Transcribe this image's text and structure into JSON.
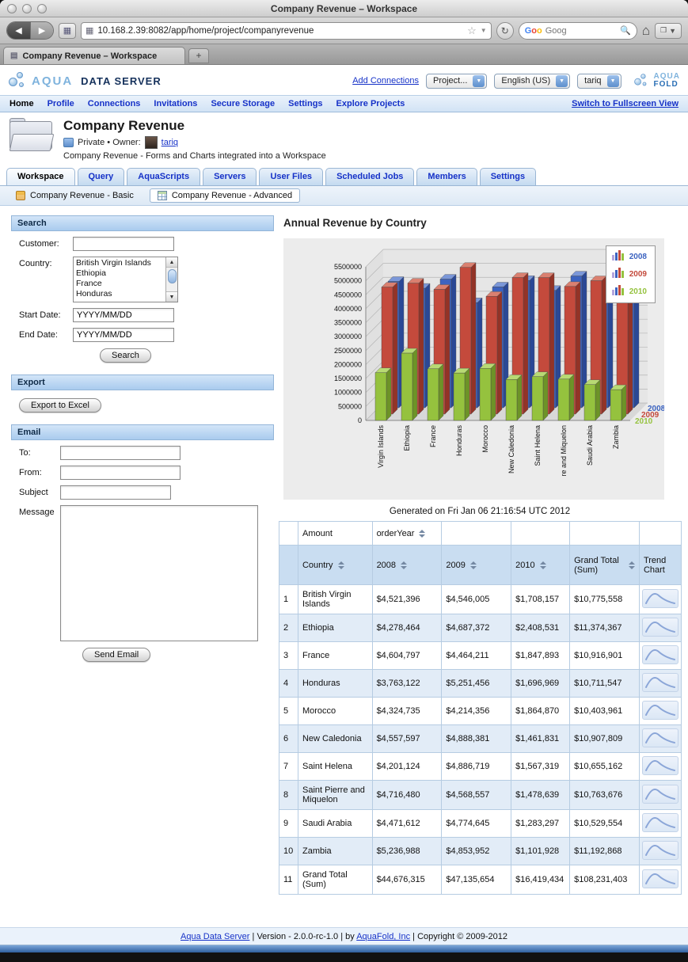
{
  "browser": {
    "window_title": "Company Revenue – Workspace",
    "url": "10.168.2.39:8082/app/home/project/companyrevenue",
    "tab_title": "Company Revenue – Workspace",
    "search_text": "Goog"
  },
  "header": {
    "brand_left_primary": "AQUA",
    "brand_left_secondary": "DATA SERVER",
    "add_connections": "Add Connections",
    "project_dropdown": "Project...",
    "language_dropdown": "English (US)",
    "user_dropdown": "tariq",
    "brand_right_line1": "AQUA",
    "brand_right_line2": "FOLD"
  },
  "nav": {
    "items": [
      {
        "label": "Home",
        "active": true
      },
      {
        "label": "Profile",
        "active": false
      },
      {
        "label": "Connections",
        "active": false
      },
      {
        "label": "Invitations",
        "active": false
      },
      {
        "label": "Secure Storage",
        "active": false
      },
      {
        "label": "Settings",
        "active": false
      },
      {
        "label": "Explore Projects",
        "active": false
      }
    ],
    "fullscreen_link": "Switch to Fullscreen View"
  },
  "project": {
    "title": "Company Revenue",
    "privacy_owner": "Private •  Owner:",
    "owner": "tariq",
    "description": "Company Revenue - Forms and Charts integrated into a Workspace"
  },
  "tabs": {
    "items": [
      {
        "label": "Workspace",
        "active": true
      },
      {
        "label": "Query",
        "active": false
      },
      {
        "label": "AquaScripts",
        "active": false
      },
      {
        "label": "Servers",
        "active": false
      },
      {
        "label": "User Files",
        "active": false
      },
      {
        "label": "Scheduled Jobs",
        "active": false
      },
      {
        "label": "Members",
        "active": false
      },
      {
        "label": "Settings",
        "active": false
      }
    ]
  },
  "subtabs": {
    "items": [
      {
        "label": "Company Revenue - Basic",
        "icon": "form-icon",
        "active": false
      },
      {
        "label": "Company Revenue - Advanced",
        "icon": "grid-icon",
        "active": true
      }
    ]
  },
  "search_form": {
    "header": "Search",
    "customer_label": "Customer:",
    "country_label": "Country:",
    "country_options": [
      "British Virgin Islands",
      "Ethiopia",
      "France",
      "Honduras"
    ],
    "start_date_label": "Start Date:",
    "end_date_label": "End Date:",
    "date_placeholder": "YYYY/MM/DD",
    "search_button_label": "Search"
  },
  "export_section": {
    "header": "Export",
    "button_label": "Export to Excel"
  },
  "email_section": {
    "header": "Email",
    "to_label": "To:",
    "from_label": "From:",
    "subject_label": "Subject",
    "message_label": "Message",
    "send_button_label": "Send Email"
  },
  "chart_section": {
    "heading": "Annual Revenue by Country",
    "caption": "Generated on Fri Jan 06 21:16:54 UTC 2012"
  },
  "chart_data": {
    "type": "bar",
    "style": "3d",
    "title": "Annual Revenue by Country",
    "categories": [
      "Virgin Islands",
      "Ethiopia",
      "France",
      "Honduras",
      "Morocco",
      "New Caledonia",
      "Saint Helena",
      "re and Miquelon",
      "Saudi Arabia",
      "Zambia"
    ],
    "series": [
      {
        "name": "2008",
        "front": "#3c63c0",
        "top": "#7b97d8",
        "side": "#2a4896",
        "values": [
          4521396,
          4278464,
          4604797,
          3763122,
          4324735,
          4557597,
          4201124,
          4716480,
          4471612,
          5236988
        ]
      },
      {
        "name": "2009",
        "front": "#c44a3c",
        "top": "#da8070",
        "side": "#933327",
        "values": [
          4546005,
          4687372,
          4464211,
          5251456,
          4214356,
          4888381,
          4886719,
          4568557,
          4774645,
          4853952
        ]
      },
      {
        "name": "2010",
        "front": "#95c23e",
        "top": "#b8da74",
        "side": "#6d9327",
        "values": [
          1708157,
          2408531,
          1847893,
          1696969,
          1864870,
          1461831,
          1567319,
          1478639,
          1283297,
          1101928
        ]
      }
    ],
    "ylim": [
      0,
      5500000
    ],
    "ytick_step": 500000,
    "legend_position": "top-right",
    "legend_icon_colors": [
      "#b3a5dd",
      "#3c63c0",
      "#c44a3c",
      "#95c23e"
    ]
  },
  "table": {
    "header1": {
      "cells": [
        {
          "text": "",
          "sort": false
        },
        {
          "text": "Amount",
          "sort": false
        },
        {
          "text": "orderYear",
          "sort": true
        },
        {
          "text": "",
          "sort": false
        },
        {
          "text": "",
          "sort": false
        },
        {
          "text": "",
          "sort": false
        },
        {
          "text": "",
          "sort": false
        }
      ]
    },
    "header2": {
      "cells": [
        {
          "text": "",
          "sort": false
        },
        {
          "text": "Country",
          "sort": true
        },
        {
          "text": "2008",
          "sort": true
        },
        {
          "text": "2009",
          "sort": true
        },
        {
          "text": "2010",
          "sort": true
        },
        {
          "text": "Grand Total (Sum)",
          "sort": true
        },
        {
          "text": "Trend Chart",
          "sort": false
        }
      ]
    },
    "rows": [
      {
        "cells": [
          "1",
          "British Virgin Islands",
          "$4,521,396",
          "$4,546,005",
          "$1,708,157",
          "$10,775,558"
        ]
      },
      {
        "cells": [
          "2",
          "Ethiopia",
          "$4,278,464",
          "$4,687,372",
          "$2,408,531",
          "$11,374,367"
        ]
      },
      {
        "cells": [
          "3",
          "France",
          "$4,604,797",
          "$4,464,211",
          "$1,847,893",
          "$10,916,901"
        ]
      },
      {
        "cells": [
          "4",
          "Honduras",
          "$3,763,122",
          "$5,251,456",
          "$1,696,969",
          "$10,711,547"
        ]
      },
      {
        "cells": [
          "5",
          "Morocco",
          "$4,324,735",
          "$4,214,356",
          "$1,864,870",
          "$10,403,961"
        ]
      },
      {
        "cells": [
          "6",
          "New Caledonia",
          "$4,557,597",
          "$4,888,381",
          "$1,461,831",
          "$10,907,809"
        ]
      },
      {
        "cells": [
          "7",
          "Saint Helena",
          "$4,201,124",
          "$4,886,719",
          "$1,567,319",
          "$10,655,162"
        ]
      },
      {
        "cells": [
          "8",
          "Saint Pierre and Miquelon",
          "$4,716,480",
          "$4,568,557",
          "$1,478,639",
          "$10,763,676"
        ]
      },
      {
        "cells": [
          "9",
          "Saudi Arabia",
          "$4,471,612",
          "$4,774,645",
          "$1,283,297",
          "$10,529,554"
        ]
      },
      {
        "cells": [
          "10",
          "Zambia",
          "$5,236,988",
          "$4,853,952",
          "$1,101,928",
          "$11,192,868"
        ]
      },
      {
        "cells": [
          "11",
          "Grand Total (Sum)",
          "$44,676,315",
          "$47,135,654",
          "$16,419,434",
          "$108,231,403"
        ]
      }
    ]
  },
  "footer": {
    "separator": "|",
    "items": [
      {
        "text": "Aqua Data Server",
        "link": true,
        "sep": true
      },
      {
        "text": "Version - 2.0.0-rc-1.0",
        "link": false,
        "sep": true
      },
      {
        "text": "by",
        "link": false,
        "sep": false
      },
      {
        "text": "AquaFold, Inc",
        "link": true,
        "sep": true
      },
      {
        "text": "Copyright © 2009-2012",
        "link": false,
        "sep": false
      }
    ]
  }
}
